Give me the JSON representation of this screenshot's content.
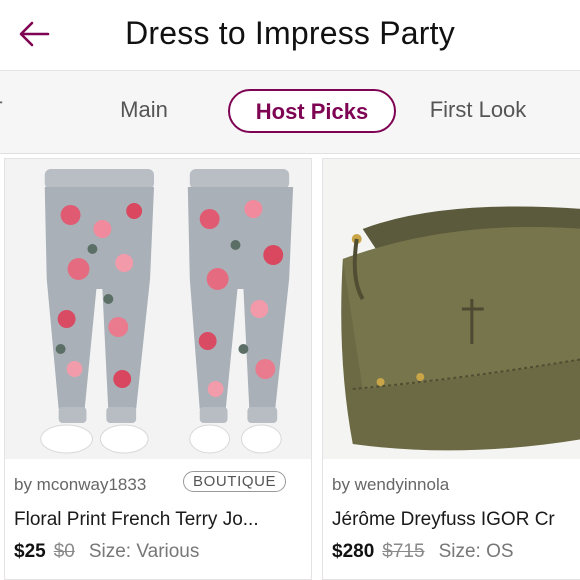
{
  "header": {
    "title": "Dress to Impress Party",
    "back_icon": "back-arrow-icon",
    "accent_color": "#7f0353"
  },
  "tabs": [
    {
      "label": "T"
    },
    {
      "label": "Main"
    },
    {
      "label": "Host Picks",
      "selected": true
    },
    {
      "label": "First Look"
    }
  ],
  "listings": [
    {
      "seller": "by mconway1833",
      "badge": "BOUTIQUE",
      "title": "Floral Print French Terry Jo...",
      "price": "$25",
      "original_price": "$0",
      "size": "Size: Various"
    },
    {
      "seller": "by wendyinnola",
      "title": "Jérôme Dreyfuss IGOR Cr",
      "price": "$280",
      "original_price": "$715",
      "size": "Size: OS"
    }
  ]
}
